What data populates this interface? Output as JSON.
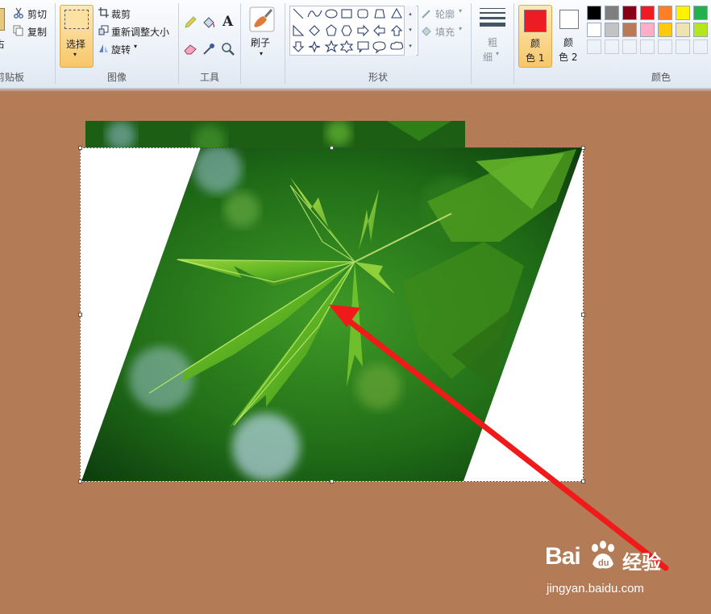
{
  "ribbon": {
    "clipboard": {
      "cut": "剪切",
      "copy": "复制",
      "paste_partial": "占",
      "label": "剪贴板"
    },
    "image": {
      "select": "选择",
      "crop": "裁剪",
      "resize": "重新调整大小",
      "rotate": "旋转",
      "label": "图像"
    },
    "tools": {
      "label": "工具"
    },
    "brushes": {
      "label": "刷子"
    },
    "shapes": {
      "outline": "轮廓",
      "fill": "填充",
      "label": "形状"
    },
    "size": {
      "line1": "粗",
      "line2": "细"
    },
    "colors": {
      "color1_a": "颜",
      "color1_b": "色 1",
      "color2_a": "颜",
      "color2_b": "色 2",
      "label": "颜色",
      "color1": "#ed1c24",
      "color2": "#ffffff",
      "palette_row1": [
        "#000000",
        "#7f7f7f",
        "#880015",
        "#ed1c24",
        "#ff7f27",
        "#fff200",
        "#22b14c"
      ],
      "palette_row2": [
        "#ffffff",
        "#c3c3c3",
        "#b97a57",
        "#ffaec9",
        "#ffc90e",
        "#efe4b0",
        "#b5e61d"
      ]
    }
  },
  "canvas": {
    "background": "#b47b57",
    "arrow_color": "#f01a1a"
  },
  "watermark": {
    "brand": "Bai",
    "brand2": "du",
    "product": "经验",
    "url": "jingyan.baidu.com"
  }
}
